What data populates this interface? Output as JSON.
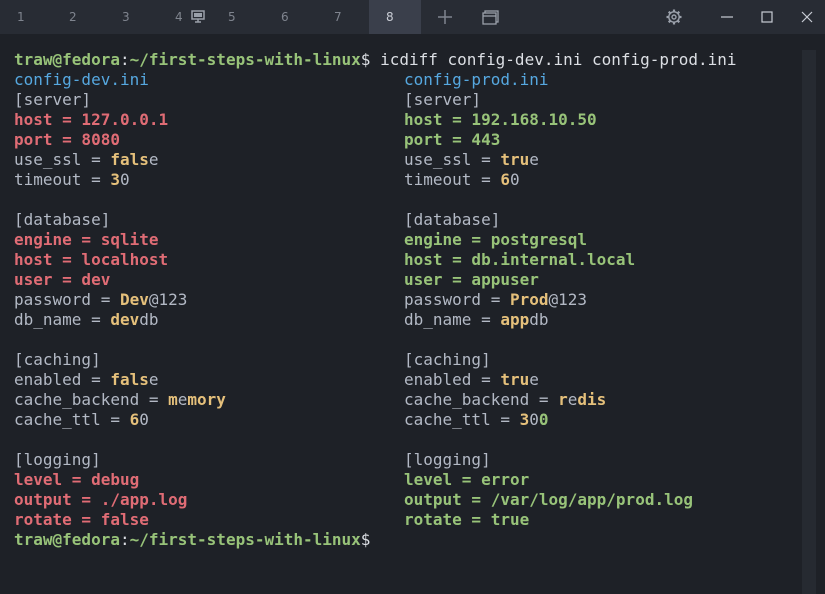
{
  "tabs": [
    {
      "label": "1"
    },
    {
      "label": "2"
    },
    {
      "label": "3"
    },
    {
      "label": "4"
    },
    {
      "label": "5"
    },
    {
      "label": "6"
    },
    {
      "label": "7"
    },
    {
      "label": "8"
    }
  ],
  "colors": {
    "background": "#1e2127",
    "removed": "#e06c75",
    "added": "#98c379",
    "changed": "#e5c07b",
    "filename": "#56a8e0"
  },
  "terminal": {
    "prompt": "traw@fedora",
    "colon": ":",
    "path": "~/first-steps-with-linux",
    "dollar": "$",
    "command": " icdiff config-dev.ini config-prod.ini",
    "left_file": "config-dev.ini",
    "right_file": "config-prod.ini",
    "rows": [
      {
        "left": [
          [
            "sec",
            "[server]"
          ]
        ],
        "right": [
          [
            "sec",
            "[server]"
          ]
        ]
      },
      {
        "left": [
          [
            "del",
            "host = 127.0.0.1"
          ]
        ],
        "right": [
          [
            "add",
            "host = 192.168.10.50"
          ]
        ]
      },
      {
        "left": [
          [
            "del",
            "port = 8080"
          ]
        ],
        "right": [
          [
            "add",
            "port = 443"
          ]
        ]
      },
      {
        "left": [
          [
            "sec",
            "use_ssl = "
          ],
          [
            "hl",
            "fals"
          ],
          [
            "sec",
            "e"
          ]
        ],
        "right": [
          [
            "sec",
            "use_ssl = "
          ],
          [
            "hl",
            "tru"
          ],
          [
            "sec",
            "e"
          ]
        ]
      },
      {
        "left": [
          [
            "sec",
            "timeout = "
          ],
          [
            "hl",
            "3"
          ],
          [
            "sec",
            "0"
          ]
        ],
        "right": [
          [
            "sec",
            "timeout = "
          ],
          [
            "hl",
            "6"
          ],
          [
            "sec",
            "0"
          ]
        ]
      },
      {
        "left": [],
        "right": []
      },
      {
        "left": [
          [
            "sec",
            "[database]"
          ]
        ],
        "right": [
          [
            "sec",
            "[database]"
          ]
        ]
      },
      {
        "left": [
          [
            "del",
            "engine = sqlite"
          ]
        ],
        "right": [
          [
            "add",
            "engine = postgresql"
          ]
        ]
      },
      {
        "left": [
          [
            "del",
            "host = localhost"
          ]
        ],
        "right": [
          [
            "add",
            "host = db.internal.local"
          ]
        ]
      },
      {
        "left": [
          [
            "del",
            "user = dev"
          ]
        ],
        "right": [
          [
            "add",
            "user = appuser"
          ]
        ]
      },
      {
        "left": [
          [
            "sec",
            "password = "
          ],
          [
            "hl",
            "Dev"
          ],
          [
            "sec",
            "@123"
          ]
        ],
        "right": [
          [
            "sec",
            "password = "
          ],
          [
            "hl",
            "Prod"
          ],
          [
            "sec",
            "@123"
          ]
        ]
      },
      {
        "left": [
          [
            "sec",
            "db_name = "
          ],
          [
            "hl",
            "dev"
          ],
          [
            "sec",
            "db"
          ]
        ],
        "right": [
          [
            "sec",
            "db_name = "
          ],
          [
            "hl",
            "app"
          ],
          [
            "sec",
            "db"
          ]
        ]
      },
      {
        "left": [],
        "right": []
      },
      {
        "left": [
          [
            "sec",
            "[caching]"
          ]
        ],
        "right": [
          [
            "sec",
            "[caching]"
          ]
        ]
      },
      {
        "left": [
          [
            "sec",
            "enabled = "
          ],
          [
            "hl",
            "fals"
          ],
          [
            "sec",
            "e"
          ]
        ],
        "right": [
          [
            "sec",
            "enabled = "
          ],
          [
            "hl",
            "tru"
          ],
          [
            "sec",
            "e"
          ]
        ]
      },
      {
        "left": [
          [
            "sec",
            "cache_backend = "
          ],
          [
            "hl",
            "m"
          ],
          [
            "sec",
            "e"
          ],
          [
            "hl",
            "mory"
          ]
        ],
        "right": [
          [
            "sec",
            "cache_backend = "
          ],
          [
            "hl",
            "r"
          ],
          [
            "sec",
            "e"
          ],
          [
            "hl",
            "dis"
          ]
        ]
      },
      {
        "left": [
          [
            "sec",
            "cache_ttl = "
          ],
          [
            "hl",
            "6"
          ],
          [
            "sec",
            "0"
          ]
        ],
        "right": [
          [
            "sec",
            "cache_ttl = "
          ],
          [
            "hl",
            "3"
          ],
          [
            "sec",
            "0"
          ],
          [
            "addhl",
            "0"
          ]
        ]
      },
      {
        "left": [],
        "right": []
      },
      {
        "left": [
          [
            "sec",
            "[logging]"
          ]
        ],
        "right": [
          [
            "sec",
            "[logging]"
          ]
        ]
      },
      {
        "left": [
          [
            "del",
            "level = debug"
          ]
        ],
        "right": [
          [
            "add",
            "level = error"
          ]
        ]
      },
      {
        "left": [
          [
            "del",
            "output = ./app.log"
          ]
        ],
        "right": [
          [
            "add",
            "output = /var/log/app/prod.log"
          ]
        ]
      },
      {
        "left": [
          [
            "del",
            "rotate = false"
          ]
        ],
        "right": [
          [
            "add",
            "rotate = true"
          ]
        ]
      }
    ]
  }
}
